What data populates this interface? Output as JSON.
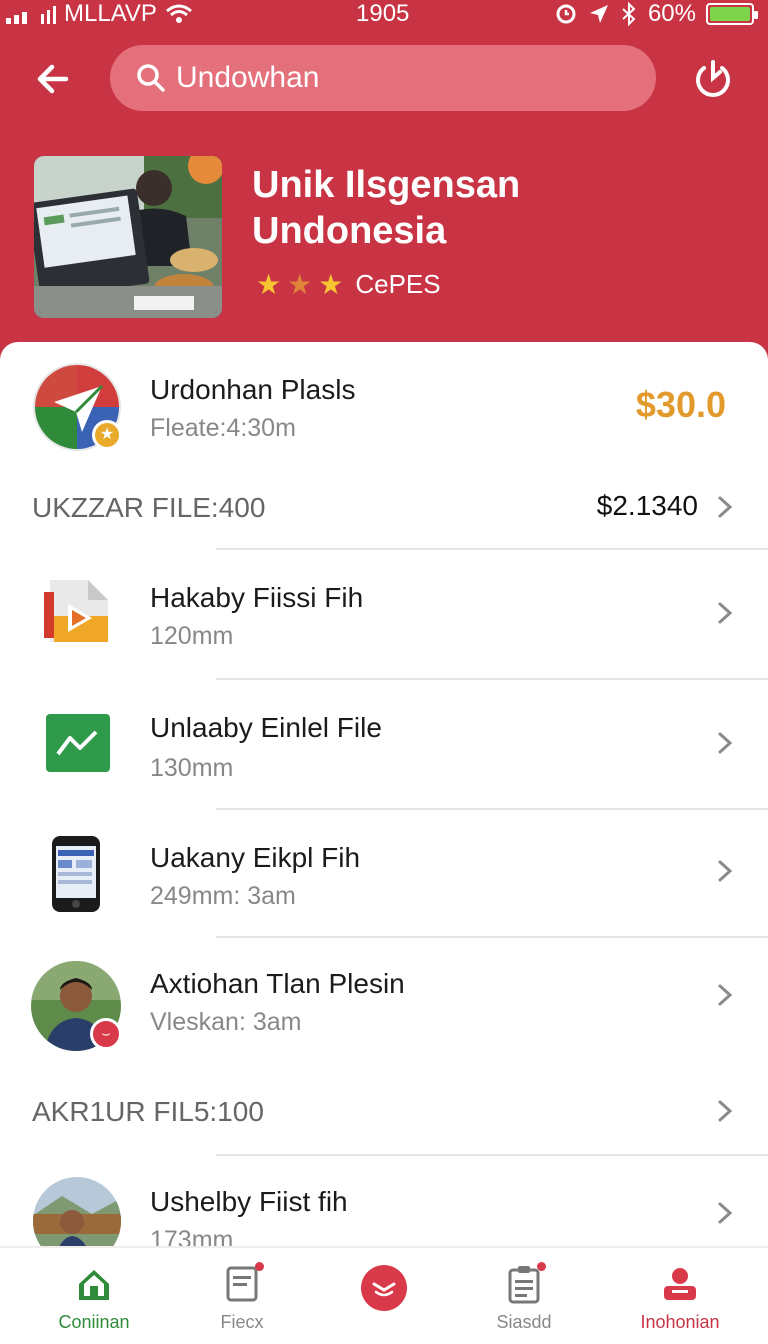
{
  "status_bar": {
    "carrier": "MLLAVP",
    "time": "1905",
    "battery": "60%"
  },
  "search": {
    "value": "Undowhan"
  },
  "hero": {
    "title_line1": "Unik Ilsgensan",
    "title_line2": "Undonesia",
    "rating_label": "CePES",
    "stars": 3
  },
  "featured": {
    "title": "Urdonhan Plasls",
    "subtitle": "Fleate:4:30m",
    "price": "$30.0"
  },
  "section1": {
    "label": "UKZZAR FILE:400",
    "value": "$2.1340"
  },
  "items": [
    {
      "title": "Hakaby Fiissi Fih",
      "subtitle": "120mm",
      "icon": "document-play-icon"
    },
    {
      "title": "Unlaaby Einlel File",
      "subtitle": "130mm",
      "icon": "chart-icon"
    },
    {
      "title": "Uakany Eikpl Fih",
      "subtitle": "249mm: 3am",
      "icon": "phone-icon"
    },
    {
      "title": "Axtiohan Tlan Plesin",
      "subtitle": "Vleskan: 3am",
      "icon": "avatar"
    }
  ],
  "section2": {
    "label": "AKR1UR FIL5:100"
  },
  "last_item": {
    "title": "Ushelby Fiist fih",
    "subtitle": "173mm"
  },
  "bottom_nav": [
    {
      "label": "Coniinan",
      "icon": "home-icon"
    },
    {
      "label": "Fiecx",
      "icon": "document-icon"
    },
    {
      "label": "",
      "icon": "center-action-icon"
    },
    {
      "label": "Siasdd",
      "icon": "clipboard-icon"
    },
    {
      "label": "Inohonian",
      "icon": "profile-icon"
    }
  ],
  "colors": {
    "brand": "#c93445",
    "price_accent": "#e39a2c",
    "active_tab": "#2f8a3a"
  }
}
